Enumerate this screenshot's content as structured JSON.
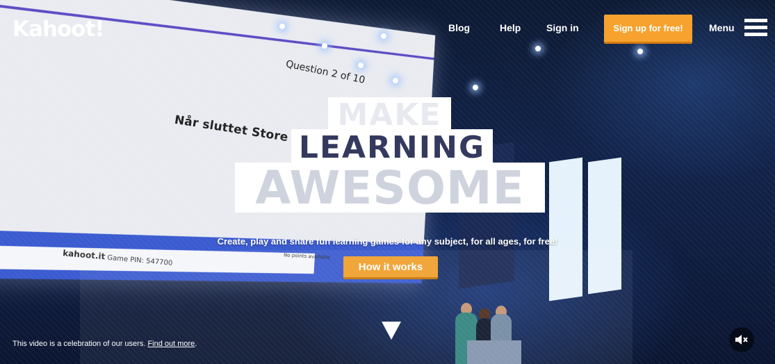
{
  "logo": {
    "text": "Kahoot!"
  },
  "nav": {
    "blog": "Blog",
    "help": "Help",
    "sign_in": "Sign in",
    "signup": "Sign up for free!",
    "menu": "Menu"
  },
  "background_video": {
    "question_counter": "Question 2 of 10",
    "question_text": "Når sluttet Store No",
    "game_pin_brand": "kahoot.it",
    "game_pin": "Game PIN: 547700",
    "no_points": "No points available"
  },
  "headline": {
    "line1": "MAKE",
    "line2": "LEARNING",
    "line3": "AWESOME"
  },
  "tagline": "Create, play and share fun learning games for any subject, for all ages, for free!",
  "cta": {
    "how_it_works": "How it works"
  },
  "caption": {
    "text": "This video is a celebration of our users. ",
    "link": "Find out more",
    "suffix": "."
  },
  "colors": {
    "accent_orange": "#f7a22e",
    "screen_purple": "#5b4bc4",
    "screen_blue": "#3b5bd0"
  },
  "icons": {
    "menu": "hamburger-icon",
    "mute": "speaker-muted-icon",
    "scroll": "arrow-down-icon"
  }
}
